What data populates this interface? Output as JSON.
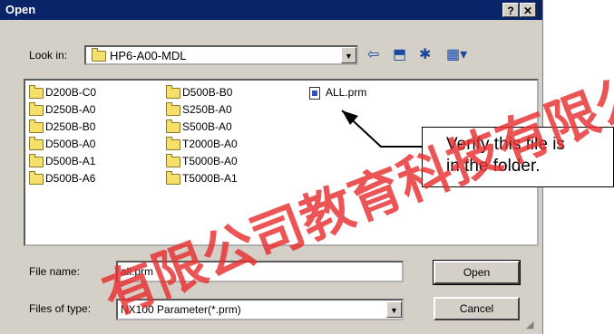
{
  "window": {
    "title": "Open",
    "help_label": "?",
    "close_label": "✕"
  },
  "lookin": {
    "label": "Look in:",
    "value": "HP6-A00-MDL"
  },
  "toolbar": {
    "back_icon": "back-arrow-icon",
    "up_icon": "up-folder-icon",
    "new_icon": "new-folder-icon",
    "view_icon": "view-menu-icon"
  },
  "files": {
    "col1": [
      "D200B-C0",
      "D250B-A0",
      "D250B-B0",
      "D500B-A0",
      "D500B-A1",
      "D500B-A6"
    ],
    "col2": [
      "D500B-B0",
      "S250B-A0",
      "S500B-A0",
      "T2000B-A0",
      "T5000B-A0",
      "T5000B-A1"
    ],
    "col3": [
      "ALL.prm"
    ]
  },
  "filename": {
    "label": "File name:",
    "value": "all.prm"
  },
  "filetype": {
    "label": "Files of type:",
    "value": "NX100 Parameter(*.prm)"
  },
  "buttons": {
    "open": "Open",
    "cancel": "Cancel"
  },
  "callout": {
    "line1": "Verify this file is",
    "line2": "in the folder."
  },
  "watermark": "有限公司教育科技有限公司"
}
